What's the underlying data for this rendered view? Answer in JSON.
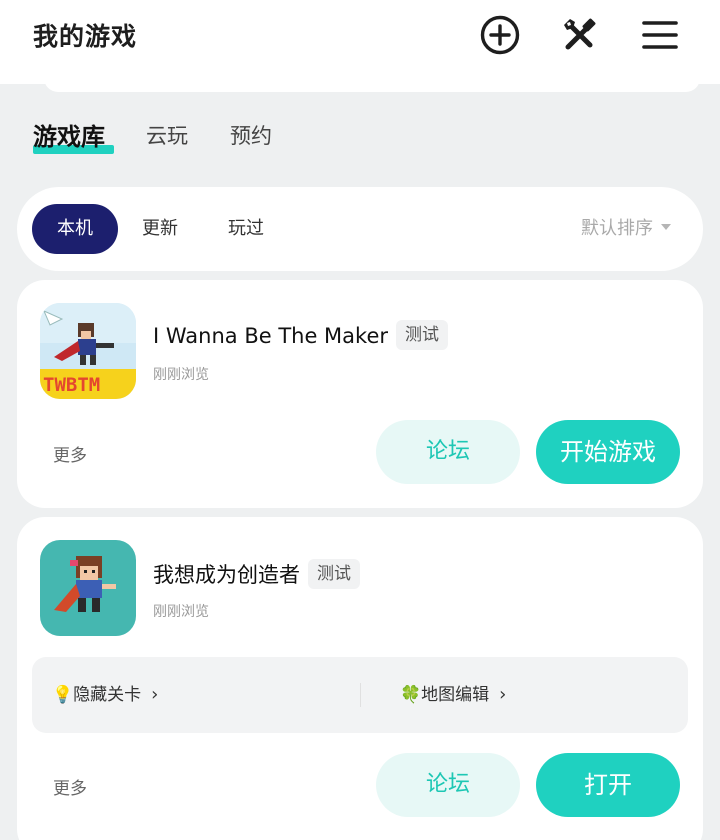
{
  "header": {
    "title": "我的游戏",
    "icons": [
      "plus-circle-icon",
      "tools-icon",
      "menu-icon"
    ]
  },
  "top_tabs": [
    {
      "label": "游戏库",
      "active": true
    },
    {
      "label": "云玩",
      "active": false
    },
    {
      "label": "预约",
      "active": false
    }
  ],
  "filters": {
    "items": [
      {
        "label": "本机",
        "active": true
      },
      {
        "label": "更新",
        "active": false
      },
      {
        "label": "玩过",
        "active": false
      }
    ],
    "sort_label": "默认排序"
  },
  "games": [
    {
      "name": "I Wanna Be The  Maker",
      "badge": "测试",
      "subtitle": "刚刚浏览",
      "more_label": "更多",
      "forum_label": "论坛",
      "primary_label": "开始游戏"
    },
    {
      "name": "我想成为创造者",
      "badge": "测试",
      "subtitle": "刚刚浏览",
      "features": [
        {
          "icon": "lightbulb-icon",
          "glyph": "💡",
          "label": "隐藏关卡"
        },
        {
          "icon": "clover-icon",
          "glyph": "🍀",
          "label": "地图编辑"
        }
      ],
      "more_label": "更多",
      "forum_label": "论坛",
      "primary_label": "打开"
    }
  ],
  "colors": {
    "accent": "#1fd1c0",
    "active_pill": "#1c1f6e",
    "forum_bg": "#e7f8f6",
    "page_bg": "#eef0f1"
  }
}
